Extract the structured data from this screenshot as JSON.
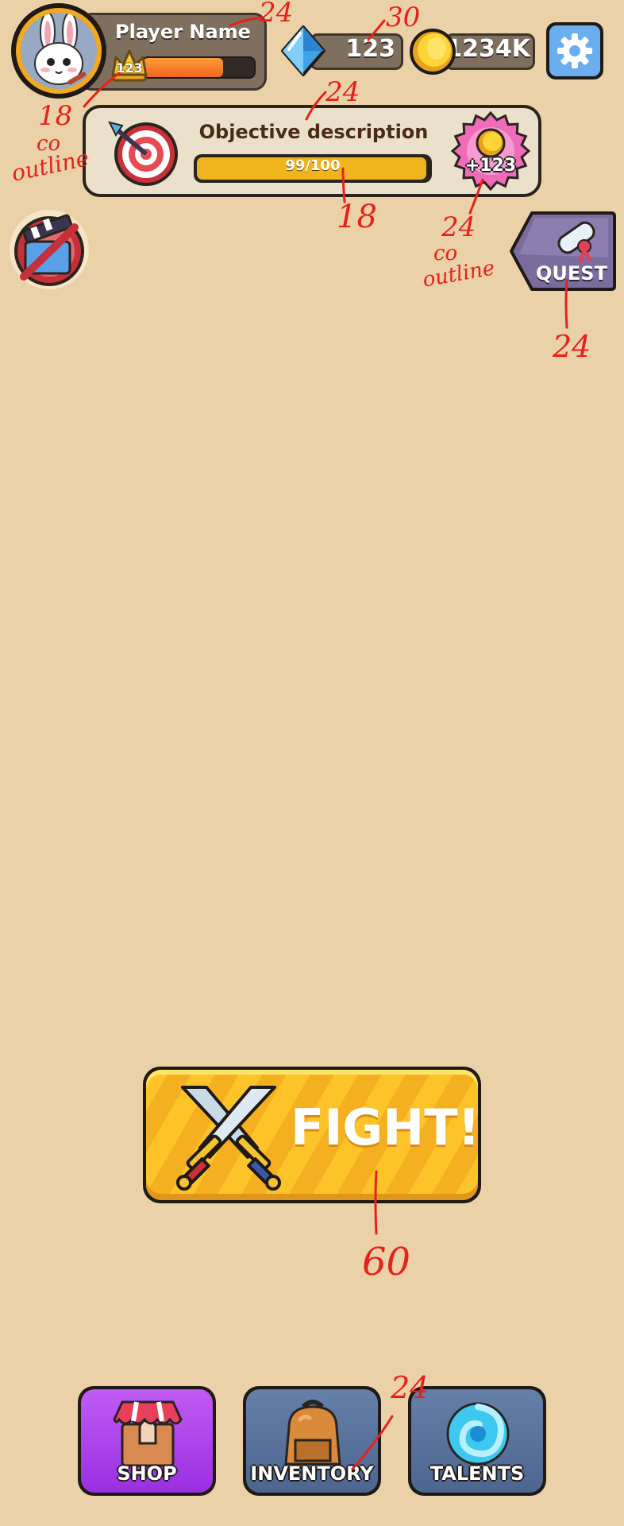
{
  "player": {
    "name": "Player Name",
    "level": "123",
    "xp_fraction": 0.72
  },
  "currency": {
    "gems": "123",
    "coins": "1234K"
  },
  "objective": {
    "description": "Objective description",
    "progress_text": "99/100",
    "progress_fraction": 0.99,
    "reward": "+123"
  },
  "quest": {
    "label": "QUEST"
  },
  "fight": {
    "label": "FIGHT!"
  },
  "nav": {
    "shop": "SHOP",
    "inventory": "INVENTORY",
    "talents": "TALENTS"
  },
  "annotations": {
    "a1": "24",
    "a2": "30",
    "a3": "24",
    "a4": "18",
    "a5": "co",
    "a6": "outline",
    "a7": "18",
    "a8": "24",
    "a9": "co",
    "a10": "outline",
    "a11": "24",
    "a12": "60",
    "a13": "24"
  },
  "colors": {
    "background": "#EBD1A8",
    "panel": "#7f6f5f",
    "objective_bar": "#f0b51c",
    "fight": "#fdc42a",
    "shop": "#b03ae8",
    "inventory": "#56729c",
    "talents": "#56729c",
    "annotation": "#e8201c"
  }
}
